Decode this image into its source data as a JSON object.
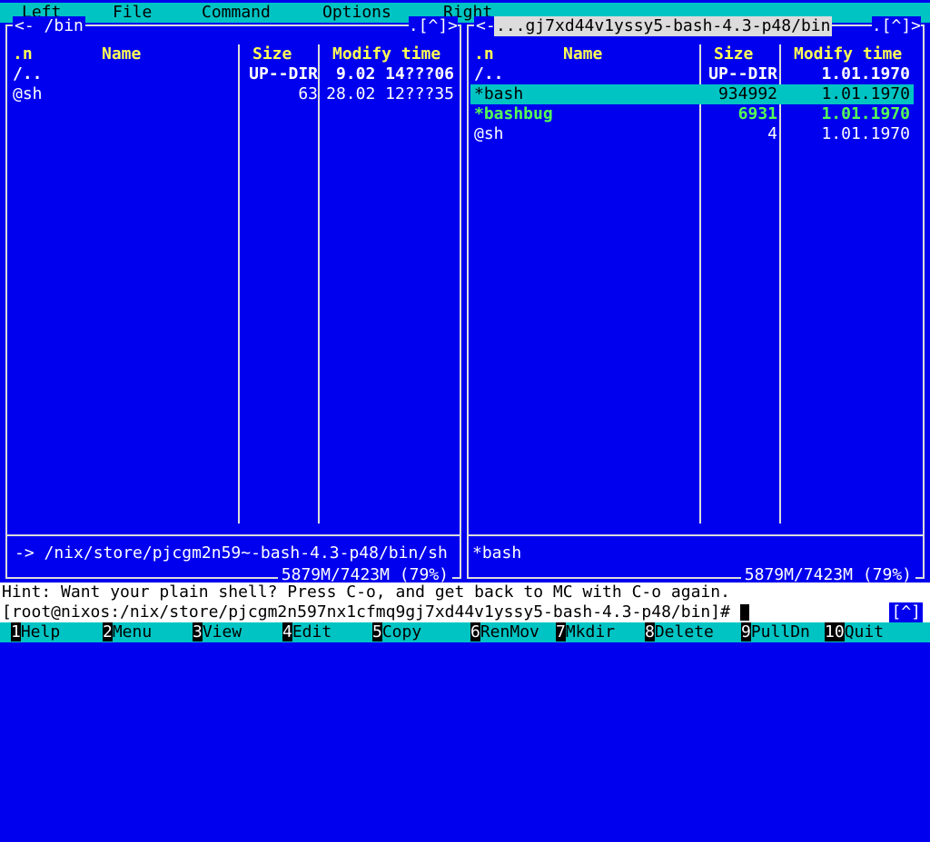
{
  "menu": {
    "items": [
      "Left",
      "File",
      "Command",
      "Options",
      "Right"
    ]
  },
  "left_panel": {
    "title": "/bin",
    "title_prefix": "<-",
    "corner": ".[^]>",
    "headers": {
      "sort": ".n",
      "name": "Name",
      "size": "Size",
      "mtime": "Modify time"
    },
    "rows": [
      {
        "name": "/..",
        "size": "UP--DIR",
        "mtime": "9.02 14???06"
      },
      {
        "name": "@sh",
        "size": "63",
        "mtime": "28.02 12???35"
      }
    ],
    "status": "-> /nix/store/pjcgm2n59~-bash-4.3-p48/bin/sh",
    "disk_info": "5879M/7423M (79%)"
  },
  "right_panel": {
    "title": "...gj7xd44v1yssy5-bash-4.3-p48/bin",
    "title_prefix": "<-",
    "corner": ".[^]>",
    "headers": {
      "sort": ".n",
      "name": "Name",
      "size": "Size",
      "mtime": "Modify time"
    },
    "rows": [
      {
        "name": "/..",
        "size": "UP--DIR",
        "mtime": "1.01.1970"
      },
      {
        "name": "*bash",
        "size": "934992",
        "mtime": "1.01.1970"
      },
      {
        "name": "*bashbug",
        "size": "6931",
        "mtime": "1.01.1970"
      },
      {
        "name": "@sh",
        "size": "4",
        "mtime": "1.01.1970"
      }
    ],
    "status": "*bash",
    "disk_info": "5879M/7423M (79%)"
  },
  "hint": "Hint: Want your plain shell? Press C-o, and get back to MC with C-o again.",
  "command_line": {
    "prompt": "[root@nixos:/nix/store/pjcgm2n597nx1cfmq9gj7xd44v1yssy5-bash-4.3-p48/bin]#",
    "button": "[^]"
  },
  "function_keys": [
    {
      "num": "1",
      "label": "Help"
    },
    {
      "num": "2",
      "label": "Menu"
    },
    {
      "num": "3",
      "label": "View"
    },
    {
      "num": "4",
      "label": "Edit"
    },
    {
      "num": "5",
      "label": "Copy"
    },
    {
      "num": "6",
      "label": "RenMov"
    },
    {
      "num": "7",
      "label": "Mkdir"
    },
    {
      "num": "8",
      "label": "Delete"
    },
    {
      "num": "9",
      "label": "PullDn"
    },
    {
      "num": "10",
      "label": "Quit"
    }
  ],
  "colors": {
    "panel_bg": "#0000ee",
    "accent": "#00c4c4",
    "header_yellow": "#ffff55",
    "executable_green": "#55ff55"
  }
}
